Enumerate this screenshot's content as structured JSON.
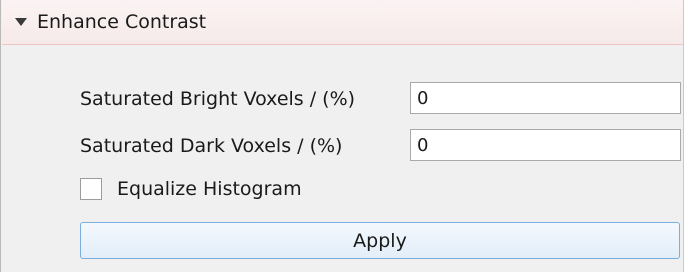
{
  "section": {
    "title": "Enhance Contrast",
    "collapse_icon": "triangle-down-icon"
  },
  "fields": {
    "bright": {
      "label": "Saturated Bright Voxels / (%)",
      "value": "0"
    },
    "dark": {
      "label": "Saturated Dark Voxels / (%)",
      "value": "0"
    }
  },
  "equalize": {
    "label": "Equalize Histogram",
    "checked": false
  },
  "apply_button": {
    "label": "Apply"
  },
  "colors": {
    "header_bg": "#f8eeee",
    "header_border": "#f0c4c4",
    "button_border": "#7aaede",
    "panel_bg": "#f0f0f0"
  }
}
